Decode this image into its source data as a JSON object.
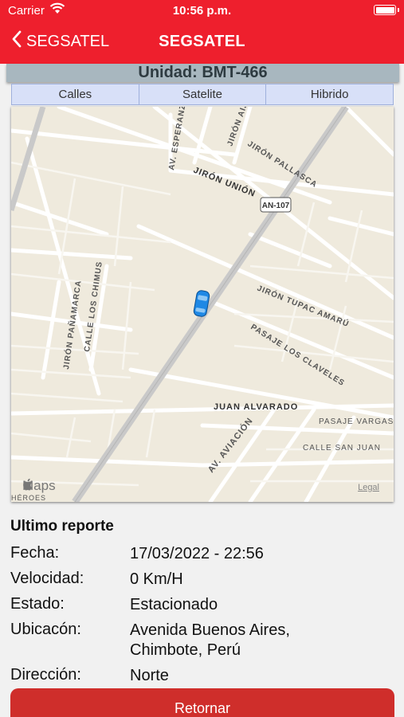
{
  "status_bar": {
    "carrier": "Carrier",
    "time": "10:56 p.m."
  },
  "nav": {
    "back_label": "SEGSATEL",
    "title": "SEGSATEL"
  },
  "unit": {
    "label": "Unidad: BMT-466"
  },
  "map_types": [
    "Calles",
    "Satelite",
    "Hibrido"
  ],
  "map": {
    "streets": [
      "JIRÓN UNIÓN",
      "AN-107",
      "JIRÓN PALLASCA",
      "AV. ESPERANZA",
      "JIRÓN AIJA",
      "JIRÓN TUPAC AMARÚ",
      "PASAJE LOS CLAVELES",
      "JIRÓN PAÑAMARCA",
      "CALLE LOS CHIMUS",
      "JUAN ALVARADO",
      "PASAJE VARGAS",
      "CALLE SAN JUAN",
      "AV. AVIACIÓN",
      "HÉROES"
    ],
    "logo": "Maps",
    "legal": "Legal"
  },
  "report": {
    "heading": "Ultimo reporte",
    "rows": [
      {
        "label": "Fecha:",
        "value": "17/03/2022 - 22:56"
      },
      {
        "label": "Velocidad:",
        "value": "0 Km/H"
      },
      {
        "label": "Estado:",
        "value": "Estacionado"
      },
      {
        "label": "Ubicacón:",
        "value": "Avenida Buenos Aires, Chimbote, Perú"
      },
      {
        "label": "Dirección:",
        "value": "Norte"
      }
    ]
  },
  "return_button": "Retornar",
  "colors": {
    "header": "#ee1f2d",
    "unit_bar": "#a8b7bf",
    "segment": "#d8e0f8",
    "return_button": "#cf2e2b",
    "vehicle": "#1e88e5"
  }
}
